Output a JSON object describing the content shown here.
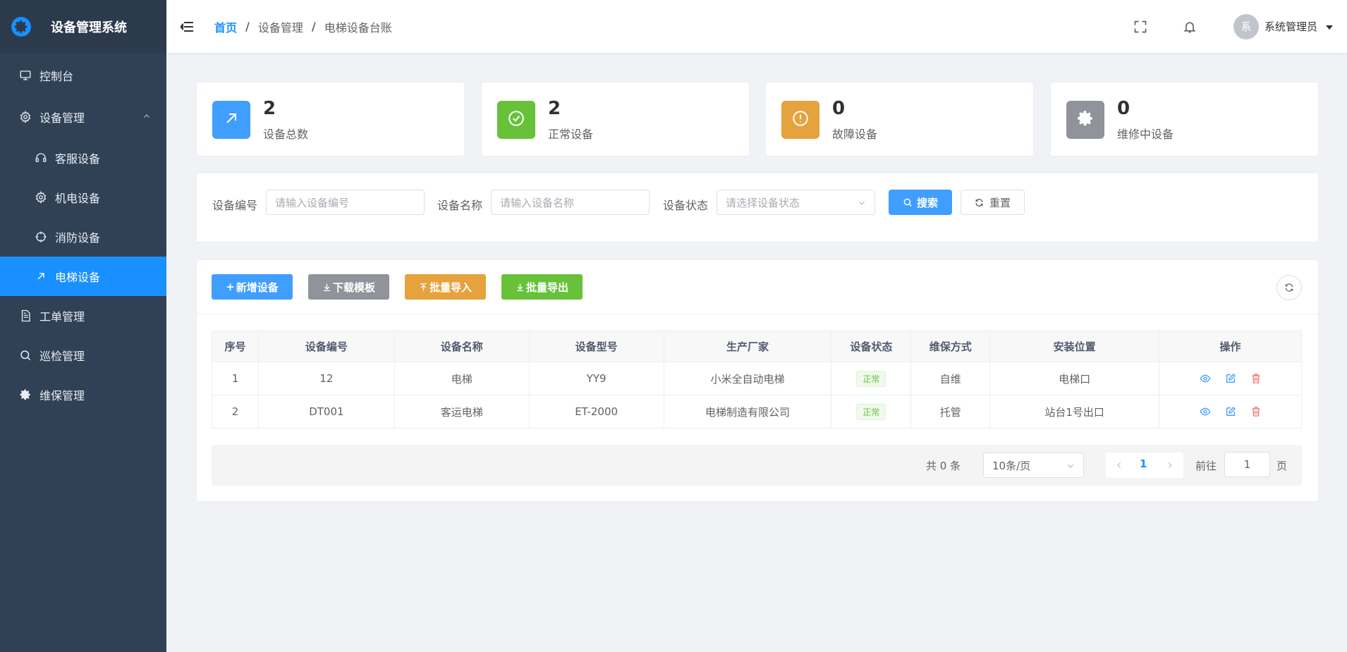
{
  "app": {
    "title": "设备管理系统"
  },
  "sidebar": {
    "items": [
      {
        "label": "控制台",
        "icon": "monitor-icon"
      },
      {
        "label": "设备管理",
        "icon": "gear-outline-icon",
        "expanded": true
      },
      {
        "label": "客服设备",
        "icon": "headset-icon"
      },
      {
        "label": "机电设备",
        "icon": "gear-outline-icon"
      },
      {
        "label": "消防设备",
        "icon": "crosshair-icon"
      },
      {
        "label": "电梯设备",
        "icon": "arrow-up-right-icon",
        "active": true
      },
      {
        "label": "工单管理",
        "icon": "document-icon"
      },
      {
        "label": "巡检管理",
        "icon": "search-icon"
      },
      {
        "label": "维保管理",
        "icon": "gear-solid-icon"
      }
    ]
  },
  "header": {
    "breadcrumb": {
      "home": "首页",
      "mid": "设备管理",
      "current": "电梯设备台账"
    },
    "user": {
      "avatar_text": "系",
      "name": "系统管理员"
    }
  },
  "stats": [
    {
      "value": "2",
      "label": "设备总数",
      "color": "#409eff",
      "icon": "arrow-up-right-icon"
    },
    {
      "value": "2",
      "label": "正常设备",
      "color": "#67c23a",
      "icon": "check-circle-icon"
    },
    {
      "value": "0",
      "label": "故障设备",
      "color": "#e6a23c",
      "icon": "warning-circle-icon"
    },
    {
      "value": "0",
      "label": "维修中设备",
      "color": "#909399",
      "icon": "gear-solid-icon"
    }
  ],
  "search": {
    "code_label": "设备编号",
    "code_placeholder": "请输入设备编号",
    "name_label": "设备名称",
    "name_placeholder": "请输入设备名称",
    "status_label": "设备状态",
    "status_placeholder": "请选择设备状态",
    "search_button": "搜索",
    "reset_button": "重置"
  },
  "toolbar": {
    "add": "新增设备",
    "download": "下载模板",
    "import": "批量导入",
    "export": "批量导出"
  },
  "table": {
    "headers": [
      "序号",
      "设备编号",
      "设备名称",
      "设备型号",
      "生产厂家",
      "设备状态",
      "维保方式",
      "安装位置",
      "操作"
    ],
    "rows": [
      [
        "1",
        "12",
        "电梯",
        "YY9",
        "小米全自动电梯",
        "正常",
        "自维",
        "电梯口"
      ],
      [
        "2",
        "DT001",
        "客运电梯",
        "ET-2000",
        "电梯制造有限公司",
        "正常",
        "托管",
        "站台1号出口"
      ]
    ]
  },
  "pagination": {
    "total": "共 0 条",
    "page_size": "10条/页",
    "current": "1",
    "goto_label": "前往",
    "goto_value": "1",
    "page_unit": "页"
  }
}
